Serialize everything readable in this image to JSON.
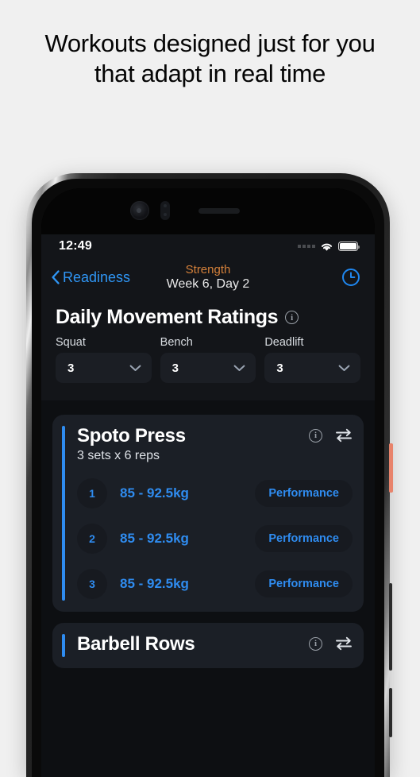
{
  "headline": "Workouts designed just for you that adapt in real time",
  "phone": {
    "buttons": {
      "power": "power-button",
      "volume": "volume-button",
      "silent": "silent-switch"
    }
  },
  "status_bar": {
    "time": "12:49",
    "signal_icon": "signal-dots-icon",
    "wifi_icon": "wifi-icon",
    "battery_icon": "battery-icon"
  },
  "nav_bar": {
    "back_label": "Readiness",
    "back_icon": "chevron-left-icon",
    "title": "Strength",
    "subtitle": "Week 6, Day 2",
    "title_color": "#d4803a",
    "accent_color": "#2f96f5",
    "timer_icon": "clock-icon"
  },
  "ratings": {
    "title": "Daily Movement Ratings",
    "info_icon": "info-icon",
    "info_glyph": "i",
    "lifts": [
      {
        "label": "Squat",
        "value": "3",
        "chevron_icon": "chevron-down-icon"
      },
      {
        "label": "Bench",
        "value": "3",
        "chevron_icon": "chevron-down-icon"
      },
      {
        "label": "Deadlift",
        "value": "3",
        "chevron_icon": "chevron-down-icon"
      }
    ]
  },
  "exercises": [
    {
      "name": "Spoto Press",
      "subtitle": "3 sets x 6 reps",
      "info_icon": "info-icon",
      "swap_icon": "swap-arrows-icon",
      "accent_color": "#2f8cf0",
      "sets": [
        {
          "number": "1",
          "weight": "85 - 92.5kg",
          "tag": "Performance"
        },
        {
          "number": "2",
          "weight": "85 - 92.5kg",
          "tag": "Performance"
        },
        {
          "number": "3",
          "weight": "85 - 92.5kg",
          "tag": "Performance"
        }
      ]
    },
    {
      "name": "Barbell Rows",
      "subtitle": "",
      "info_icon": "info-icon",
      "swap_icon": "swap-arrows-icon",
      "accent_color": "#2f8cf0",
      "sets": []
    }
  ]
}
